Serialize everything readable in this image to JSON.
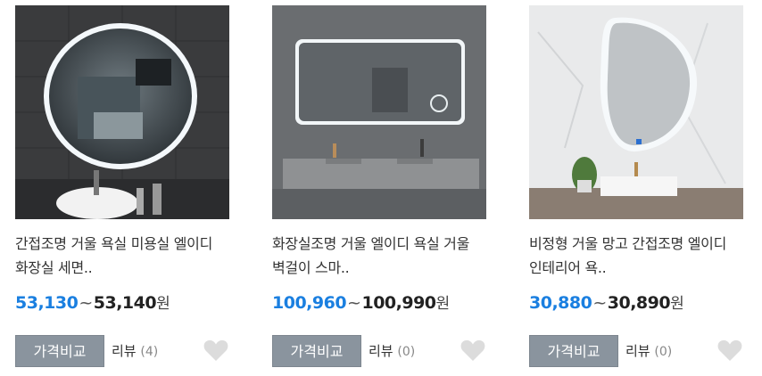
{
  "products": [
    {
      "image": "round-led-bathroom-mirror",
      "title": "간접조명 거울 욕실 미용실 엘이디 화장실 세면..",
      "price_low": "53,130",
      "price_high": "53,140",
      "currency": "원",
      "compare_label": "가격비교",
      "review_label": "리뷰",
      "review_count": "(4)",
      "wish_icon": "heart-icon"
    },
    {
      "image": "rectangular-led-mirror-with-vanity",
      "title": "화장실조명 거울 엘이디 욕실 거울 벽걸이 스마..",
      "price_low": "100,960",
      "price_high": "100,990",
      "currency": "원",
      "compare_label": "가격비교",
      "review_label": "리뷰",
      "review_count": "(0)",
      "wish_icon": "heart-icon"
    },
    {
      "image": "irregular-mango-shaped-led-mirror",
      "title": "비정형 거울 망고 간접조명 엘이디 인테리어 욕..",
      "price_low": "30,880",
      "price_high": "30,890",
      "currency": "원",
      "compare_label": "가격비교",
      "review_label": "리뷰",
      "review_count": "(0)",
      "wish_icon": "heart-icon"
    }
  ],
  "colors": {
    "price_low": "#1a7fe0",
    "compare_button": "#8a949e",
    "heart": "#dcdcdc"
  }
}
